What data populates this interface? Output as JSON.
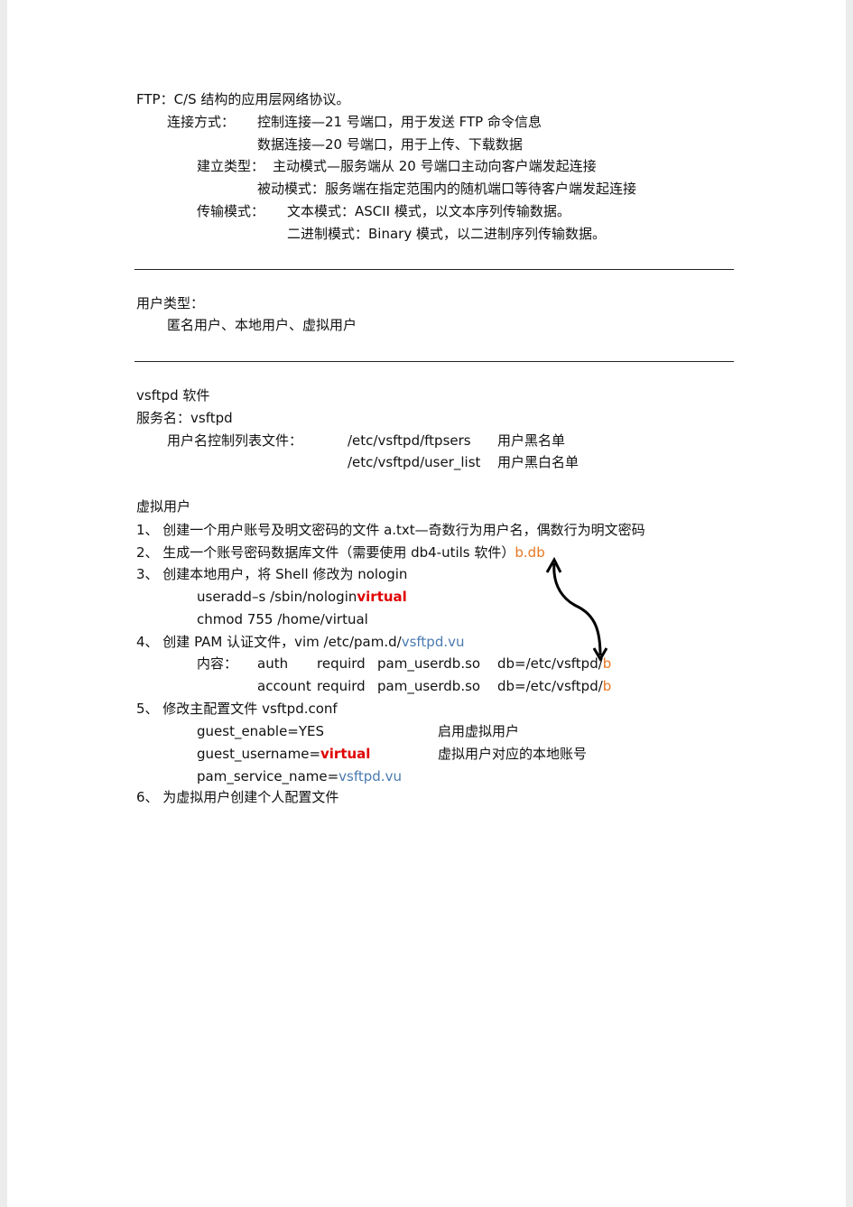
{
  "ftp": {
    "title": "FTP：C/S 结构的应用层网络协议。",
    "conn_label": "连接方式：",
    "conn1": "控制连接—21 号端口，用于发送 FTP 命令信息",
    "conn2": "数据连接—20 号端口，用于上传、下载数据",
    "est_label": "建立类型：",
    "est1": "主动模式—服务端从 20 号端口主动向客户端发起连接",
    "est2": "被动模式：服务端在指定范围内的随机端口等待客户端发起连接",
    "trans_label": "传输模式：",
    "trans1": "文本模式：ASCII 模式，以文本序列传输数据。",
    "trans2": "二进制模式：Binary 模式，以二进制序列传输数据。"
  },
  "users": {
    "title": "用户类型：",
    "list": "匿名用户、本地用户、虚拟用户"
  },
  "vsftpd": {
    "title": "vsftpd 软件",
    "service": "服务名：vsftpd",
    "list_label": "用户名控制列表文件：",
    "file1": "/etc/vsftpd/ftpsers",
    "desc1": "用户黑名单",
    "file2": "/etc/vsftpd/user_list",
    "desc2": "用户黑白名单"
  },
  "virtual": {
    "title": "虚拟用户",
    "s1": "1、 创建一个用户账号及明文密码的文件 a.txt—奇数行为用户名，偶数行为明文密码",
    "s2": "2、 生成一个账号密码数据库文件（需要使用 db4-utils 软件）",
    "s2_file": "b.db",
    "s3": "3、 创建本地用户，将 Shell 修改为 nologin",
    "s3_cmd1": "useradd–s  /sbin/nologin",
    "s3_cmd1_user": "virtual",
    "s3_cmd2": "chmod  755  /home/virtual",
    "s4": "4、 创建 PAM 认证文件，vim  /etc/pam.d/",
    "s4_file": "vsftpd.vu",
    "s4_label": "内容：",
    "pam_rows": [
      {
        "type": "auth",
        "control": "requird",
        "module": "pam_userdb.so",
        "arg": "db=/etc/vsftpd/",
        "arg_file": "b"
      },
      {
        "type": "account",
        "control": "requird",
        "module": "pam_userdb.so",
        "arg": "db=/etc/vsftpd/",
        "arg_file": "b"
      }
    ],
    "s5": "5、 修改主配置文件 vsftpd.conf",
    "c1": "guest_enable=YES",
    "c1_desc": "启用虚拟用户",
    "c2": "guest_username=",
    "c2_val": "virtual",
    "c2_desc": "虚拟用户对应的本地账号",
    "c3": "pam_service_name=",
    "c3_val": "vsftpd.vu",
    "s6": "6、 为虚拟用户创建个人配置文件"
  },
  "colors": {
    "orange": "#e87722",
    "red": "#e00000",
    "blue": "#4a7ab0"
  }
}
